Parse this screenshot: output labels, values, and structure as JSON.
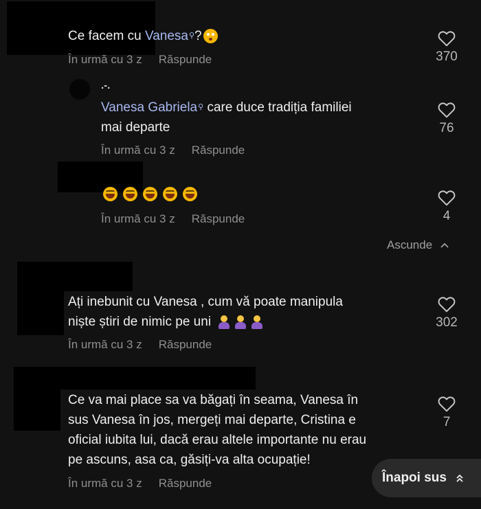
{
  "comments": [
    {
      "text_parts": [
        "Ce facem cu ",
        "Vanesa",
        "?"
      ],
      "time": "În urmă cu 3 z",
      "reply": "Răspunde",
      "likes": "370"
    },
    {
      "username": ".-.",
      "text_parts": [
        "Vanesa Gabriela",
        " care duce tradiția familiei",
        "mai departe"
      ],
      "time": "În urmă cu 3 z",
      "reply": "Răspunde",
      "likes": "76"
    },
    {
      "time": "În urmă cu 3 z",
      "reply": "Răspunde",
      "likes": "4"
    },
    {
      "text_lines": [
        "Ați inebunit cu Vanesa , cum vă poate manipula",
        "niște știri de nimic pe uni"
      ],
      "time": "În urmă cu 3 z",
      "reply": "Răspunde",
      "likes": "302"
    },
    {
      "text_lines": [
        "Ce va mai place sa va băgați în seama, Vanesa în",
        "sus Vanesa în jos, mergeți mai departe, Cristina e",
        "oficial iubita lui, dacă erau altele importante nu erau",
        "pe ascuns, asa ca, găsiți-va alta ocupație!"
      ],
      "time": "În urmă cu 3 z",
      "reply": "Răspunde",
      "likes": "7"
    }
  ],
  "hide_label": "Ascunde",
  "back_to_top": "Înapoi sus",
  "icons": {
    "like": "heart-outline-icon",
    "mention_tag": "search-tag-icon",
    "hide": "chevron-up-icon",
    "back_to_top": "double-chevron-up-icon"
  }
}
